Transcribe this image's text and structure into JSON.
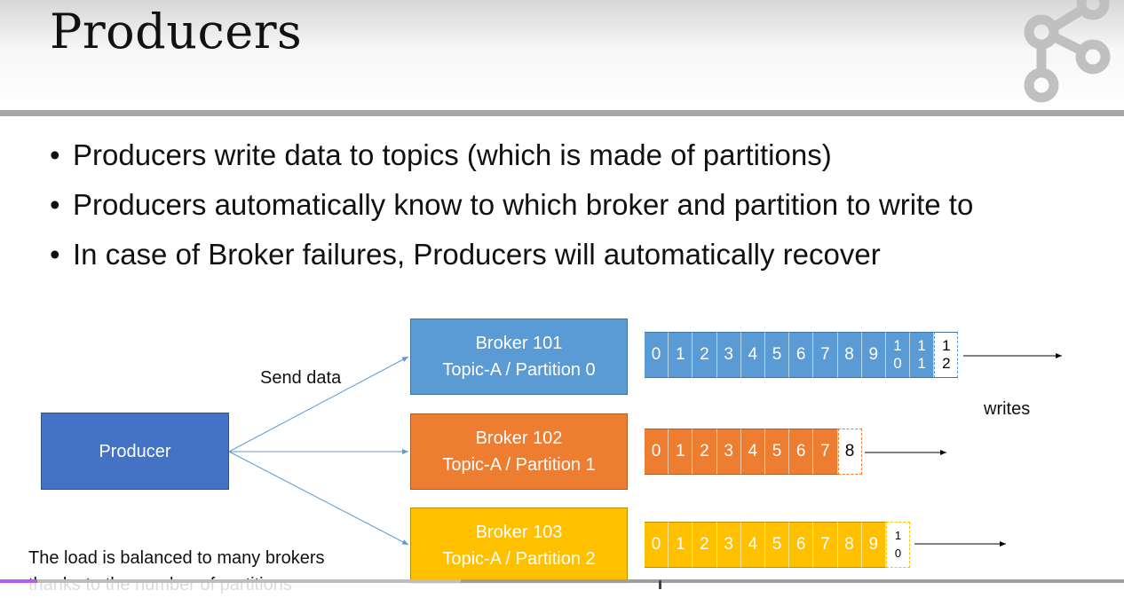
{
  "slide": {
    "title": "Producers",
    "bullets": [
      "Producers write data to topics (which is made of partitions)",
      "Producers automatically know to which broker and partition to write to",
      "In case of Broker failures, Producers will automatically recover"
    ]
  },
  "diagram": {
    "producer_label": "Producer",
    "send_label": "Send data",
    "writes_label": "writes",
    "note_lines": [
      "The load is balanced to many brokers",
      "thanks to the number of partitions"
    ],
    "brokers": [
      {
        "name": "Broker 101",
        "topic": "Topic-A / Partition 0",
        "color": "#5b9bd5"
      },
      {
        "name": "Broker 102",
        "topic": "Topic-A / Partition 1",
        "color": "#ed7d31"
      },
      {
        "name": "Broker 103",
        "topic": "Topic-A / Partition 2",
        "color": "#ffc000"
      }
    ],
    "partition0": {
      "offsets": [
        "0",
        "1",
        "2",
        "3",
        "4",
        "5",
        "6",
        "7",
        "8",
        "9"
      ],
      "two_digit": [
        [
          "1",
          "0"
        ],
        [
          "1",
          "1"
        ]
      ],
      "new_offset": [
        "1",
        "2"
      ]
    },
    "partition1": {
      "offsets": [
        "0",
        "1",
        "2",
        "3",
        "4",
        "5",
        "6",
        "7"
      ],
      "new_offset": "8"
    },
    "partition2": {
      "offsets": [
        "0",
        "1",
        "2",
        "3",
        "4",
        "5",
        "6",
        "7",
        "8",
        "9"
      ],
      "new_offset": [
        "1",
        "0"
      ]
    }
  },
  "video_player": {
    "played_fraction": 0.033,
    "loaded_fraction": 0.41
  },
  "colors": {
    "producer": "#4472c4",
    "arrow": "#5b9bd5",
    "played": "#b65cf0"
  }
}
